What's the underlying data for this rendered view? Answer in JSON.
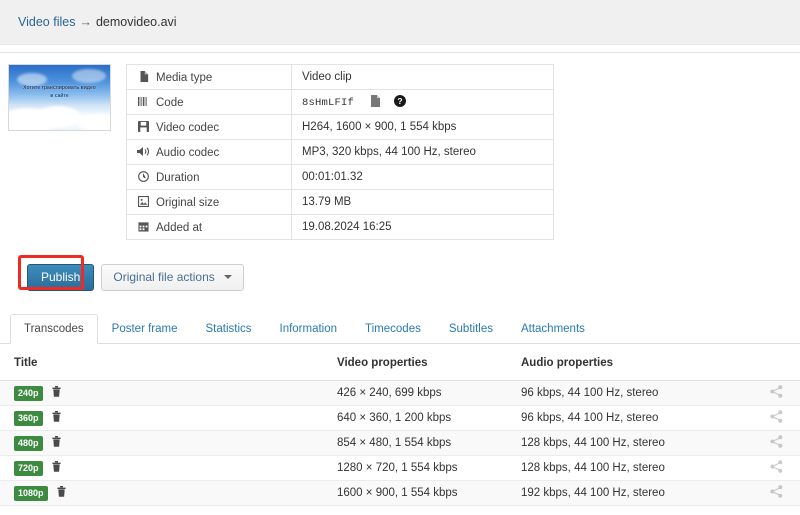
{
  "breadcrumb": {
    "root_label": "Video files",
    "separator": "→",
    "current_label": "demovideo.avi"
  },
  "thumbnail": {
    "icon": "video-thumbnail",
    "overlay_line1": "Хотите транслировать видео",
    "overlay_line2": "в сайте"
  },
  "media_info": {
    "rows": [
      {
        "icon": "file-icon",
        "label": "Media type",
        "value": "Video clip"
      },
      {
        "icon": "barcode-icon",
        "label": "Code",
        "value": "8sHmLFIf"
      },
      {
        "icon": "floppy-icon",
        "label": "Video codec",
        "value": "H264, 1600 × 900, 1 554 kbps"
      },
      {
        "icon": "volume-icon",
        "label": "Audio codec",
        "value": "MP3, 320 kbps, 44 100 Hz, stereo"
      },
      {
        "icon": "clock-icon",
        "label": "Duration",
        "value": "00:01:01.32"
      },
      {
        "icon": "image-icon",
        "label": "Original size",
        "value": "13.79 MB"
      },
      {
        "icon": "calendar-icon",
        "label": "Added at",
        "value": "19.08.2024 16:25"
      }
    ],
    "code_copy_icon": "copy-icon",
    "code_help_icon": "help-icon"
  },
  "toolbar": {
    "publish_label": "Publish",
    "original_actions_label": "Original file actions",
    "dropdown_icon": "caret-down-icon",
    "highlight_color": "#ee2b23",
    "publish_color": "#3c8dbc"
  },
  "tabs": {
    "active_index": 0,
    "items": [
      {
        "label": "Transcodes"
      },
      {
        "label": "Poster frame"
      },
      {
        "label": "Statistics"
      },
      {
        "label": "Information"
      },
      {
        "label": "Timecodes"
      },
      {
        "label": "Subtitles"
      },
      {
        "label": "Attachments"
      }
    ]
  },
  "transcodes": {
    "headers": {
      "title": "Title",
      "video": "Video properties",
      "audio": "Audio properties",
      "share": ""
    },
    "delete_icon": "trash-icon",
    "share_icon": "share-icon",
    "badge_color": "#3d8b40",
    "rows": [
      {
        "badge": "240p",
        "video": "426 × 240, 699 kbps",
        "audio": "96 kbps, 44 100 Hz, stereo"
      },
      {
        "badge": "360p",
        "video": "640 × 360, 1 200 kbps",
        "audio": "96 kbps, 44 100 Hz, stereo"
      },
      {
        "badge": "480p",
        "video": "854 × 480, 1 554 kbps",
        "audio": "128 kbps, 44 100 Hz, stereo"
      },
      {
        "badge": "720p",
        "video": "1280 × 720, 1 554 kbps",
        "audio": "128 kbps, 44 100 Hz, stereo"
      },
      {
        "badge": "1080p",
        "video": "1600 × 900, 1 554 kbps",
        "audio": "192 kbps, 44 100 Hz, stereo"
      }
    ]
  }
}
